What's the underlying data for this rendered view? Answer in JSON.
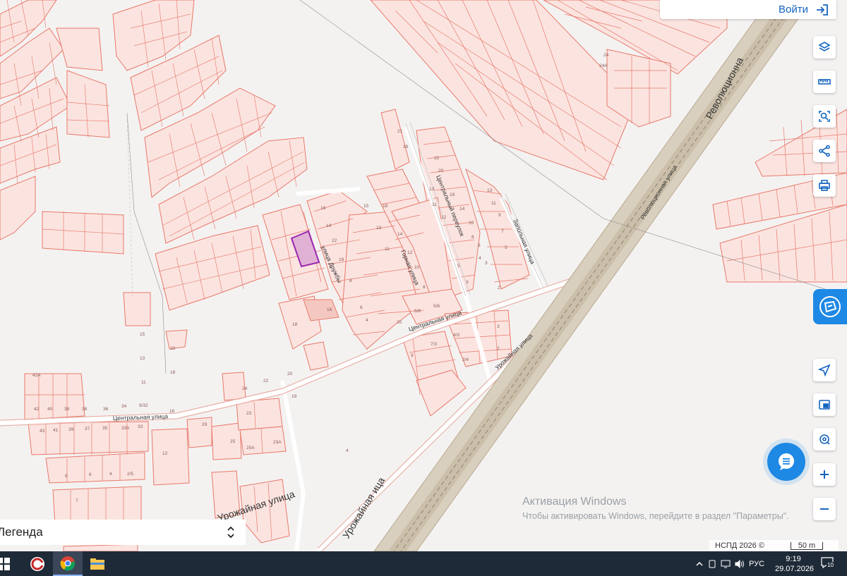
{
  "header": {
    "login_label": "Войти"
  },
  "toolbar": {
    "buttons": [
      "layers-icon",
      "ruler-icon",
      "select-area-icon",
      "share-icon",
      "print-icon",
      "locate-icon",
      "minimap-icon",
      "geo-pin-icon",
      "zoom-in-icon",
      "zoom-out-icon"
    ]
  },
  "legend": {
    "label": "Легенда"
  },
  "watermark": {
    "title": "Активация Windows",
    "subtitle": "Чтобы активировать Windows, перейдите в раздел \"Параметры\"."
  },
  "attribution": {
    "text": "НСПД 2026 ©",
    "scale": "50 m"
  },
  "map": {
    "streets": [
      "улица Дружбы",
      "Горная улица",
      "Центральный переулок",
      "Запольная улица",
      "Центральная улица",
      "Урожайная улица",
      "Революционная улица",
      "Революционна",
      "Урожайная ица",
      "Урожайная улица"
    ],
    "parcel_labels": [
      "24",
      "24А",
      "21",
      "19",
      "22",
      "24",
      "20",
      "16",
      "15",
      "18",
      "14",
      "12",
      "13",
      "11",
      "16",
      "14",
      "12",
      "10",
      "22",
      "18",
      "11",
      "13",
      "14",
      "12",
      "10",
      "9",
      "7",
      "5",
      "3",
      "1",
      "8",
      "6",
      "4",
      "2",
      "5/8",
      "5/6",
      "4/3",
      "7/3",
      "9",
      "4",
      "3",
      "8",
      "6",
      "4",
      "2",
      "20",
      "16",
      "15",
      "13",
      "11",
      "18",
      "20",
      "24",
      "22",
      "19",
      "23",
      "29",
      "25",
      "25А",
      "23А",
      "12",
      "4",
      "42А",
      "42",
      "40",
      "38",
      "36",
      "34",
      "9/32",
      "43",
      "41",
      "39",
      "37",
      "35",
      "33А",
      "33",
      "8",
      "6",
      "4",
      "2/5",
      "7",
      "16"
    ],
    "accent": "#e8786a",
    "fill": "#fbe4e0",
    "selected_fill": "#e1b1d5",
    "selected_stroke": "#9c27b0"
  },
  "taskbar": {
    "apps": [
      "windows-start-icon",
      "ccleaner-icon",
      "chrome-icon",
      "file-explorer-icon"
    ],
    "tray": {
      "language": "РУС",
      "time": "9:19",
      "date": "29.07.2026",
      "notifications": "10"
    }
  }
}
